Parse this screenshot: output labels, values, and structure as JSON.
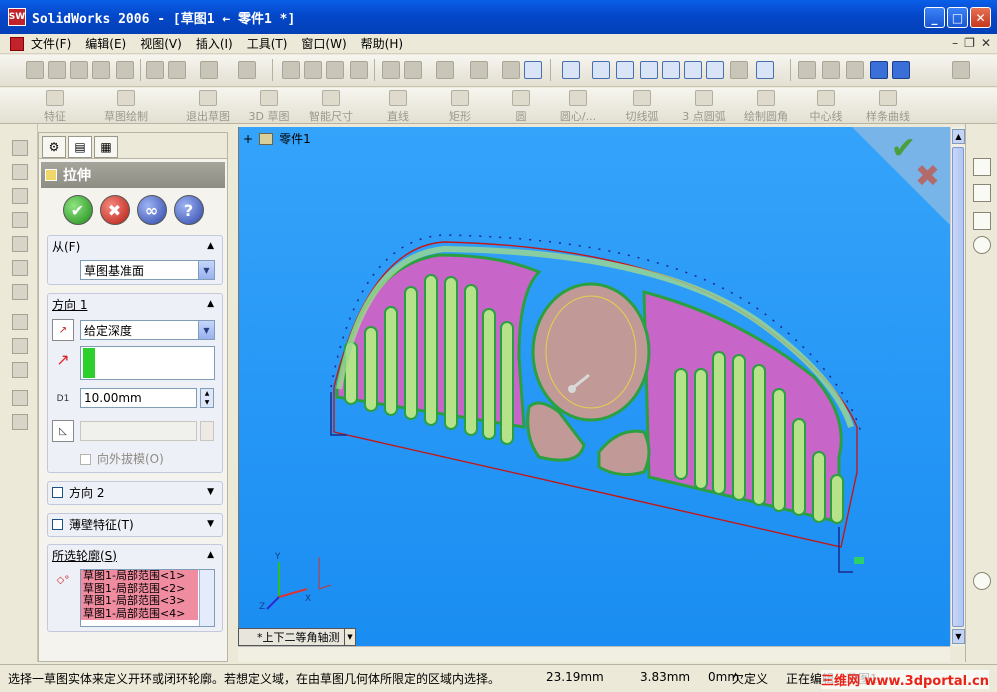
{
  "window": {
    "title": "SolidWorks 2006 - [草图1 ← 零件1 *]"
  },
  "menu": [
    "文件(F)",
    "编辑(E)",
    "视图(V)",
    "插入(I)",
    "工具(T)",
    "窗口(W)",
    "帮助(H)"
  ],
  "sketch_toolbar": [
    "特征",
    "草图绘制",
    "退出草图",
    "3D 草图",
    "智能尺寸",
    "直线",
    "矩形",
    "圆",
    "圆心/...",
    "切线弧",
    "3 点圆弧",
    "绘制圆角",
    "中心线",
    "样条曲线"
  ],
  "property_manager": {
    "title": "拉伸",
    "from": {
      "label": "从(F)",
      "value": "草图基准面"
    },
    "direction1": {
      "label": "方向 1",
      "end_condition": "给定深度",
      "depth": "10.00mm",
      "draft_outward": "向外拔模(O)",
      "depth_icon_label": "D1"
    },
    "direction2": {
      "label": "方向 2"
    },
    "thin_feature": {
      "label": "薄壁特征(T)"
    },
    "selected_contours": {
      "label": "所选轮廓(S)",
      "items": [
        "草图1-局部范围<1>",
        "草图1-局部范围<2>",
        "草图1-局部范围<3>",
        "草图1-局部范围<4>"
      ]
    }
  },
  "viewport": {
    "tree_item": "零件1",
    "view_tab": "*上下二等角轴测",
    "triad": {
      "x": "X",
      "y": "Y",
      "z": "Z"
    }
  },
  "status": {
    "message": "选择一草图实体来定义开环或闭环轮廓。若想定义域，在由草图几何体所限定的区域内选择。",
    "x": "23.19mm",
    "y": "3.83mm",
    "z": "0mm",
    "state": "欠定义",
    "mode": "正在编辑：草图1"
  },
  "watermark": "三维网 www.3dportal.cn"
}
